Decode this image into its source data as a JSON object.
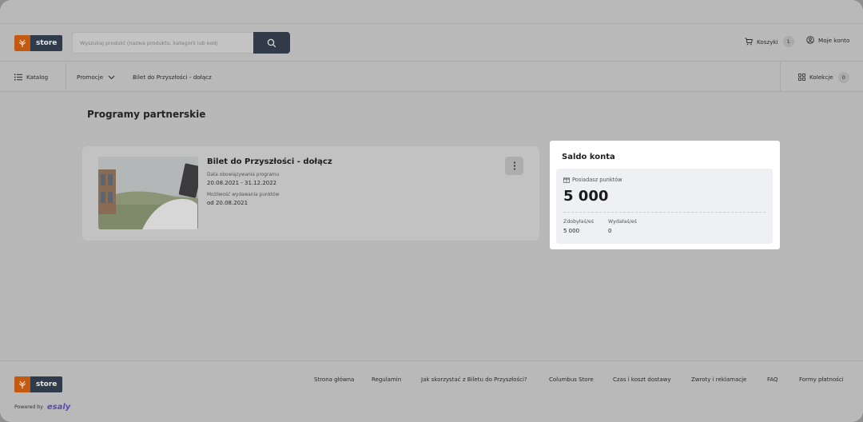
{
  "brand": {
    "logo_text": "store"
  },
  "header": {
    "search_placeholder": "Wyszukaj produkt (nazwa produktu, kategorii lub kod)",
    "cart_label": "Koszyki",
    "cart_count": "1",
    "account_label": "Moje konto"
  },
  "nav": {
    "catalog": "Katalog",
    "promotions": "Promocje",
    "ticket_link": "Bilet do Przyszłości - dołącz",
    "collections": "Kolekcje",
    "collections_count": "0"
  },
  "main": {
    "title": "Programy partnerskie",
    "program": {
      "name": "Bilet do Przyszłości - dołącz",
      "validity_label": "Data obowiązywania programu",
      "validity_value": "20.08.2021 - 31.12.2022",
      "spend_label": "Możliwość wydawania punktów",
      "spend_value": "od 20.08.2021"
    }
  },
  "saldo": {
    "title": "Saldo konta",
    "points_label": "Posiadasz punktów",
    "points_value": "5 000",
    "earned_label": "Zdobyłaś/eś",
    "earned_value": "5 000",
    "spent_label": "Wydałaś/eś",
    "spent_value": "0"
  },
  "footer": {
    "links": [
      "Strona główna",
      "Regulamin",
      "Jak skorzystać z Biletu do Przyszłości?",
      "Columbus Store",
      "Czas i koszt dostawy",
      "Zwroty i reklamacje",
      "FAQ",
      "Formy płatności"
    ],
    "powered_by": "Powered by",
    "powered_brand": "esaly"
  },
  "colors": {
    "overlay": "#b8b8b8",
    "search_button": "#303a48",
    "logo_orange": "#c25a12",
    "logo_navy": "#2f3a4a",
    "panel": "#ffffff",
    "panel_inner": "#eef0f3",
    "esaly": "#5b4ab0"
  },
  "icons": {
    "search": "search-icon",
    "cart": "cart-icon",
    "account": "user-circle-icon",
    "catalog": "list-icon",
    "chevron": "chevron-down-icon",
    "collections": "grid-icon",
    "more": "more-vertical-icon",
    "gift": "gift-icon"
  }
}
